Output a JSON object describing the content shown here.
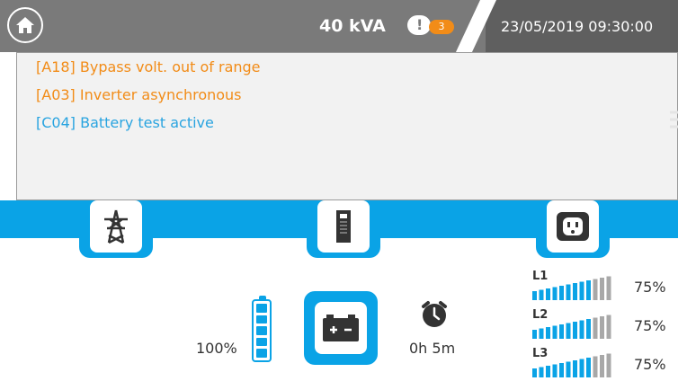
{
  "header": {
    "power": "40 kVA",
    "alarm_count": "3",
    "alarm_symbol": "!",
    "datetime": "23/05/2019 09:30:00"
  },
  "alarms": [
    {
      "text": "[A18] Bypass volt. out of range",
      "color": "#f28c18"
    },
    {
      "text": "[A03] Inverter asynchronous",
      "color": "#f28c18"
    },
    {
      "text": "[C04] Battery test active",
      "color": "#29a4e0"
    }
  ],
  "battery": {
    "percent_label": "100%",
    "level": 1.0,
    "icon": "battery-icon"
  },
  "autonomy": {
    "label": "0h 5m",
    "icon": "alarm-clock-icon"
  },
  "loads": [
    {
      "name": "L1",
      "percent_label": "75%",
      "level": 0.75
    },
    {
      "name": "L2",
      "percent_label": "75%",
      "level": 0.75
    },
    {
      "name": "L3",
      "percent_label": "75%",
      "level": 0.75
    }
  ],
  "icons": {
    "home": "home-icon",
    "grid": "transmission-tower-icon",
    "ups": "ups-cabinet-icon",
    "load": "power-socket-icon",
    "battery_tile": "car-battery-icon"
  },
  "colors": {
    "accent": "#0aa3e6",
    "warning": "#f28c18",
    "info": "#29a4e0"
  }
}
